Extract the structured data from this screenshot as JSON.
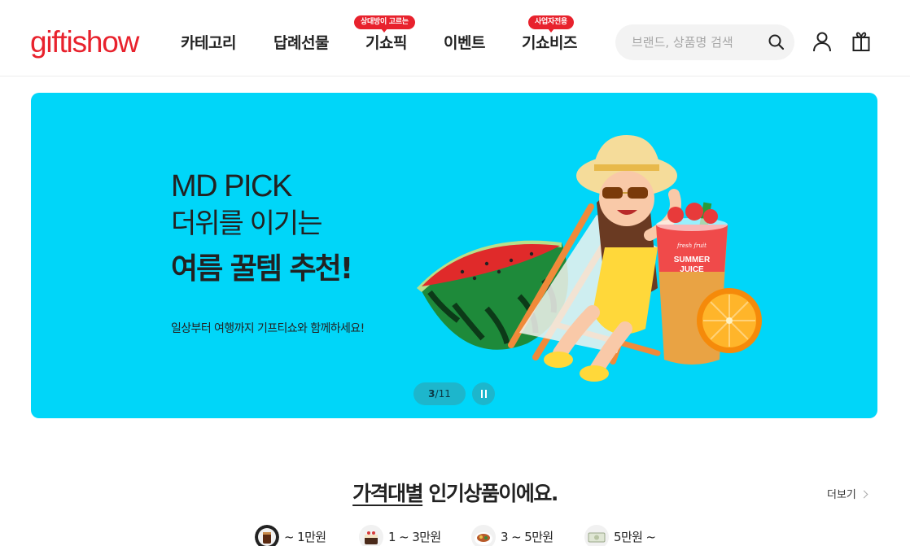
{
  "header": {
    "logo": "giftishow",
    "nav": [
      {
        "label": "카테고리",
        "badge": ""
      },
      {
        "label": "답례선물",
        "badge": ""
      },
      {
        "label": "기쇼픽",
        "badge": "상대방이 고르는"
      },
      {
        "label": "이벤트",
        "badge": ""
      },
      {
        "label": "기쇼비즈",
        "badge": "사업자전용"
      }
    ],
    "search": {
      "placeholder": "브랜드, 상품명 검색",
      "value": ""
    },
    "icons": [
      "search-icon",
      "user-icon",
      "gift-box-icon"
    ]
  },
  "banner": {
    "tag": "MD PICK",
    "subtitle": "더위를 이기는",
    "headline": "여름 꿀템 추천!",
    "description": "일상부터 여행까지 기프티쇼와 함께하세요!",
    "pager_current": "3",
    "pager_total": "11",
    "cup_brand": "fresh fruit",
    "cup_label_line1": "SUMMER",
    "cup_label_line2": "JUICE",
    "background_color": "#00d6f9"
  },
  "section": {
    "title_underlined": "가격대별",
    "title_rest": " 인기상품이에요.",
    "more_label": "더보기",
    "price_tabs": [
      {
        "label": "~ 1만원",
        "icon": "coffee-icon"
      },
      {
        "label": "1 ~ 3만원",
        "icon": "cake-icon"
      },
      {
        "label": "3 ~ 5만원",
        "icon": "food-plate-icon"
      },
      {
        "label": "5만원 ~",
        "icon": "gift-card-icon"
      }
    ]
  },
  "colors": {
    "brand": "#e8222d",
    "banner": "#00d6f9",
    "pager": "#1db6cc"
  }
}
